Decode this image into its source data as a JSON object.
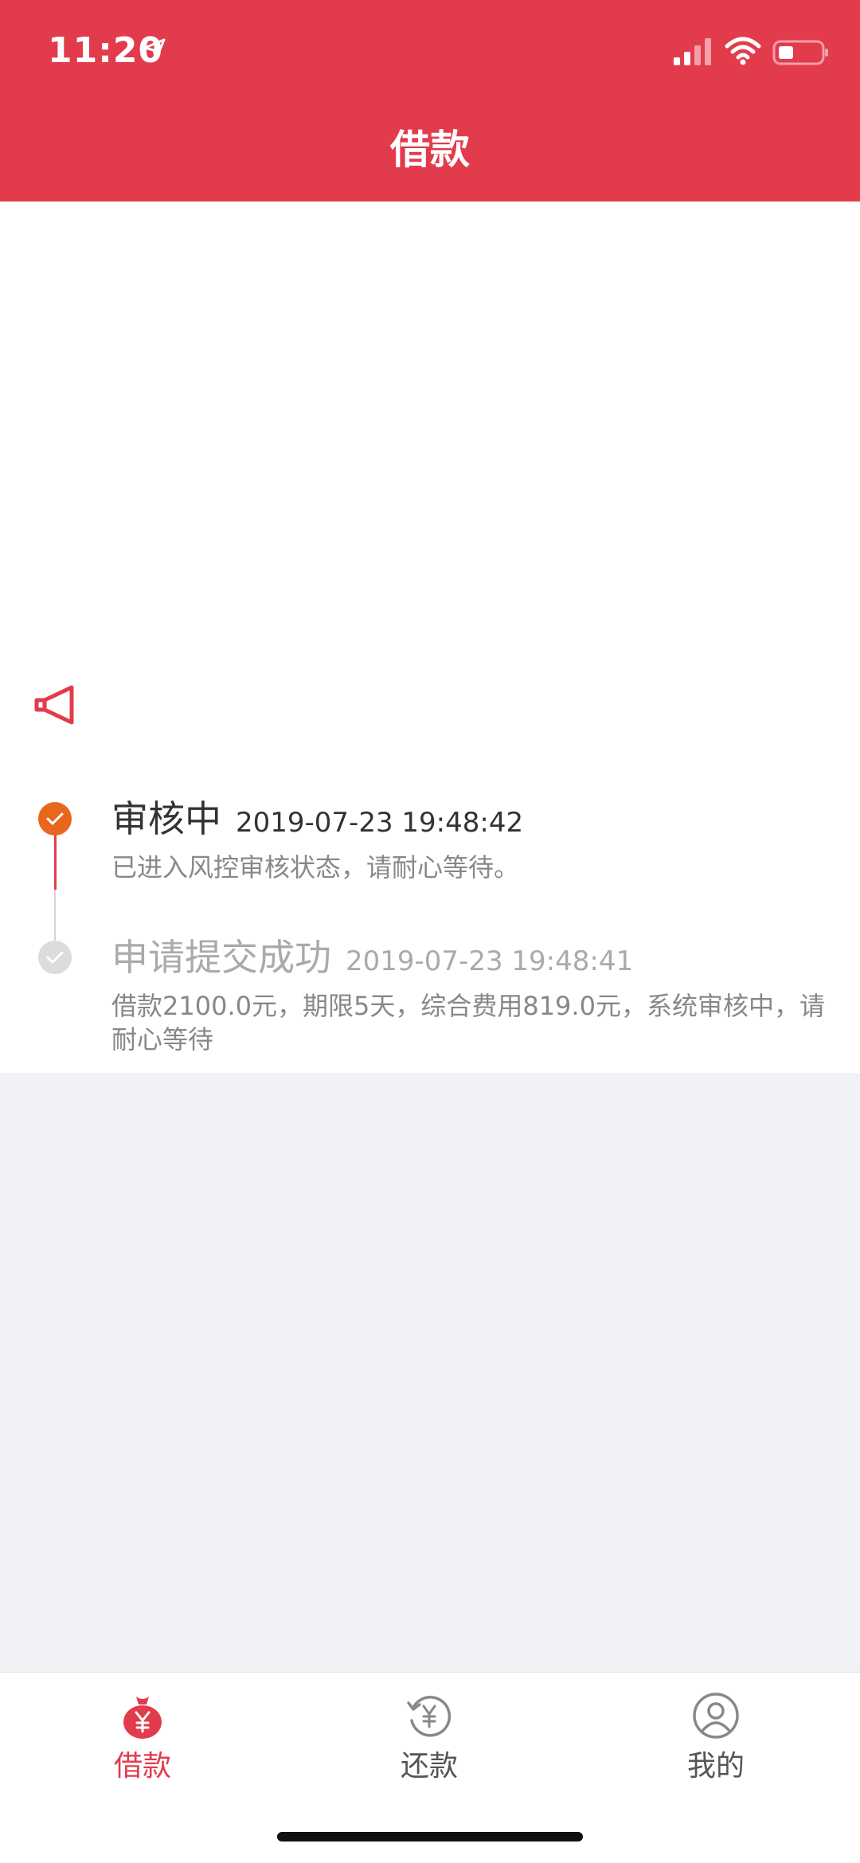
{
  "status_bar": {
    "time": "11:20"
  },
  "header": {
    "title": "借款"
  },
  "timeline": [
    {
      "title": "审核中",
      "time": "2019-07-23 19:48:42",
      "description": "已进入风控审核状态，请耐心等待。",
      "state": "active"
    },
    {
      "title": "申请提交成功",
      "time": "2019-07-23 19:48:41",
      "description": "借款2100.0元，期限5天，综合费用819.0元，系统审核中，请耐心等待",
      "state": "done"
    }
  ],
  "tabbar": {
    "items": [
      {
        "label": "借款",
        "icon": "money-bag-icon",
        "active": true
      },
      {
        "label": "还款",
        "icon": "repay-cycle-icon",
        "active": false
      },
      {
        "label": "我的",
        "icon": "user-circle-icon",
        "active": false
      }
    ]
  },
  "colors": {
    "brand": "#e23b4c",
    "active_step": "#e8661d",
    "done_step": "#dcdcdc",
    "page_background": "#f0f2f6"
  }
}
